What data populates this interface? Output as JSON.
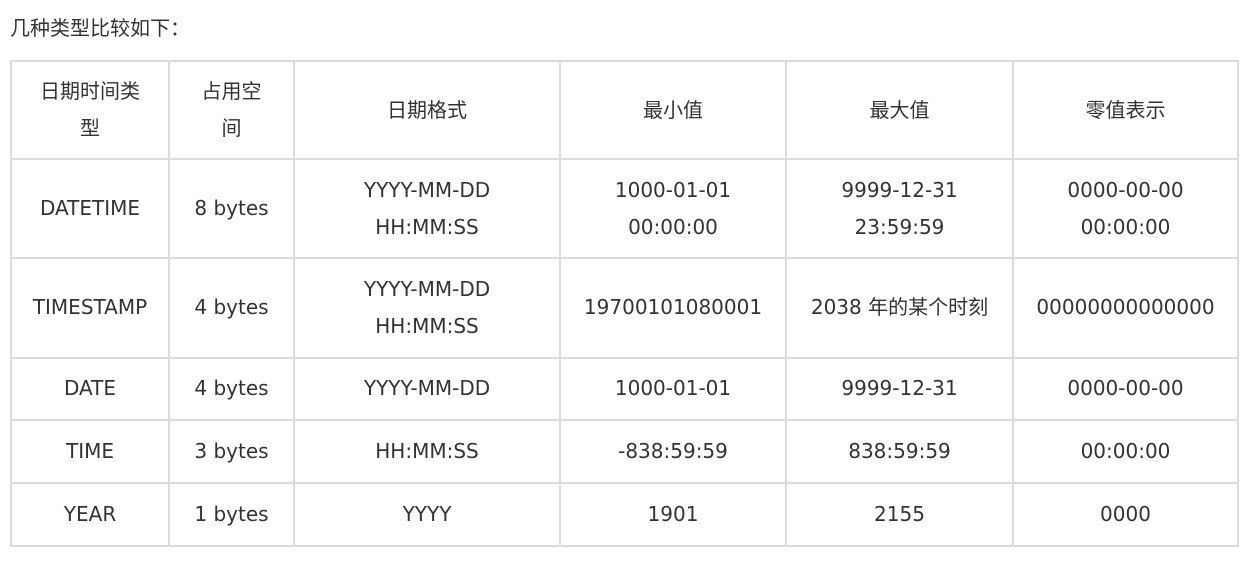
{
  "intro": "几种类型比较如下：",
  "table": {
    "headers": [
      "日期时间类型",
      "占用空间",
      "日期格式",
      "最小值",
      "最大值",
      "零值表示"
    ],
    "rows": [
      [
        "DATETIME",
        "8 bytes",
        "YYYY-MM-DD HH:MM:SS",
        "1000-01-01 00:00:00",
        "9999-12-31 23:59:59",
        "0000-00-00 00:00:00"
      ],
      [
        "TIMESTAMP",
        "4 bytes",
        "YYYY-MM-DD HH:MM:SS",
        "19700101080001",
        "2038 年的某个时刻",
        "00000000000000"
      ],
      [
        "DATE",
        "4 bytes",
        "YYYY-MM-DD",
        "1000-01-01",
        "9999-12-31",
        "0000-00-00"
      ],
      [
        "TIME",
        "3 bytes",
        "HH:MM:SS",
        "-838:59:59",
        "838:59:59",
        "00:00:00"
      ],
      [
        "YEAR",
        "1 bytes",
        "YYYY",
        "1901",
        "2155",
        "0000"
      ]
    ]
  }
}
